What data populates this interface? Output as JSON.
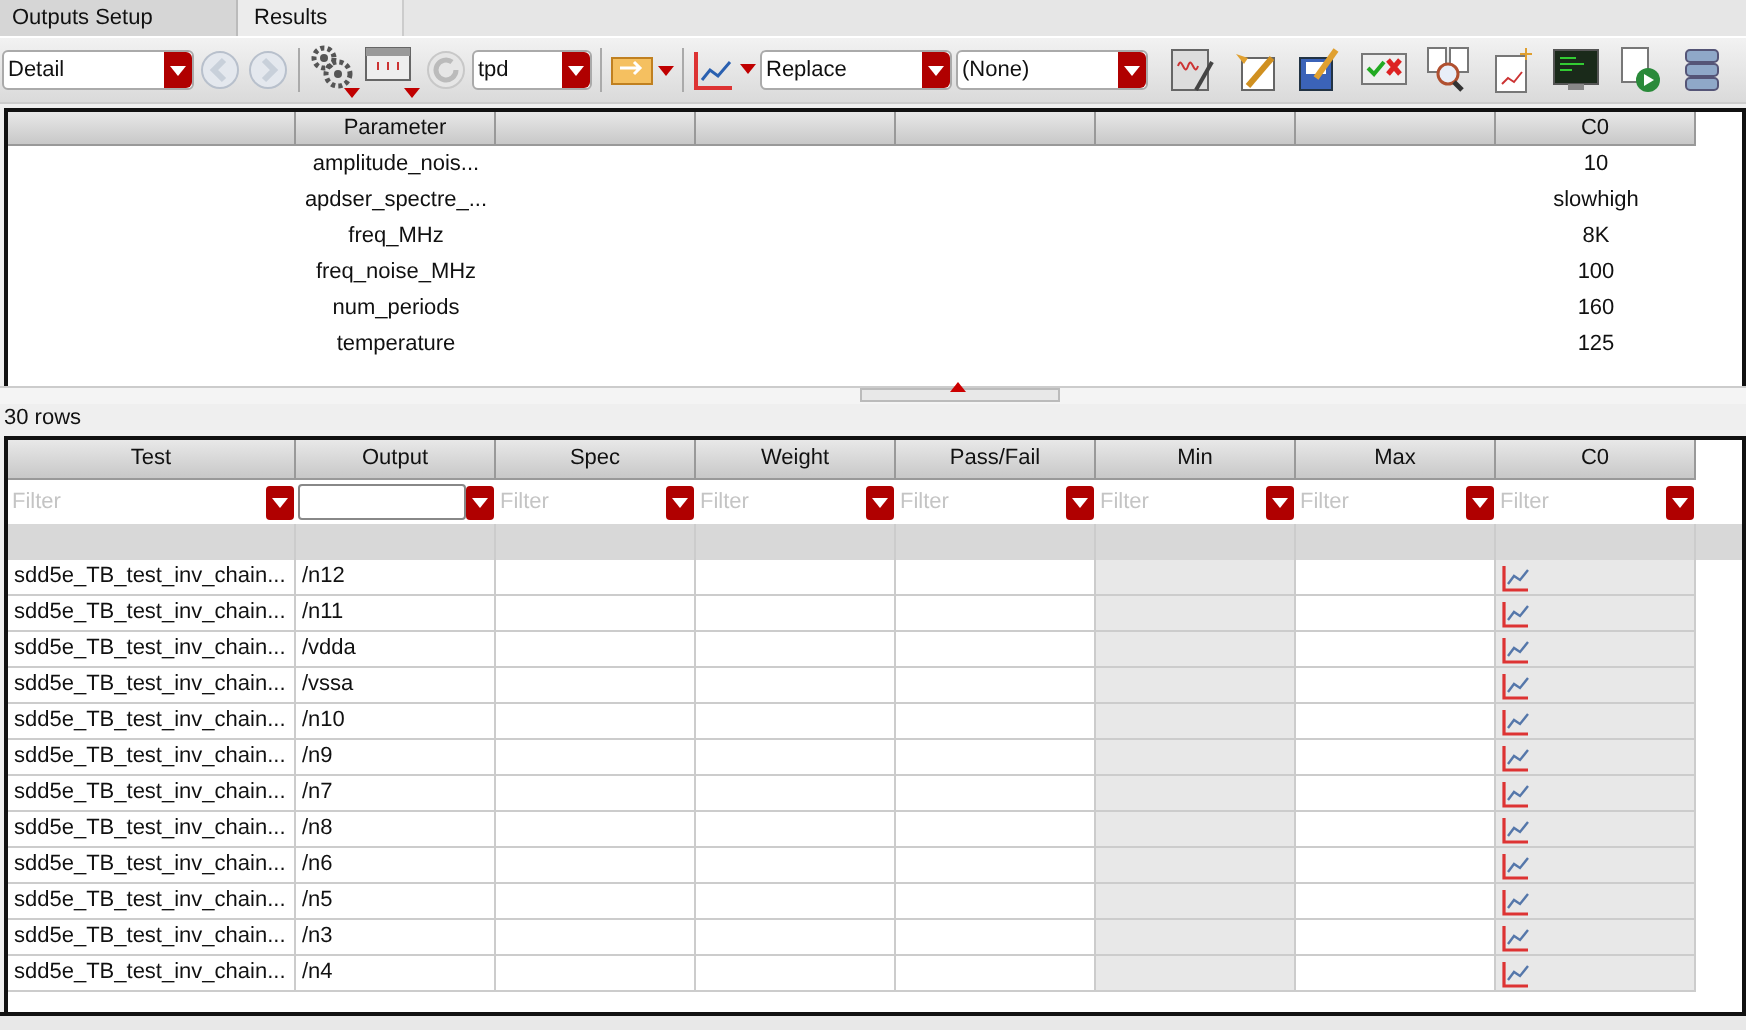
{
  "tabs": [
    {
      "label": "Outputs Setup",
      "selected": false
    },
    {
      "label": "Results",
      "selected": true
    }
  ],
  "toolbar": {
    "view_combo": "Detail",
    "test_combo": "tpd",
    "plot_mode_combo": "Replace",
    "filter_combo": "(None)"
  },
  "parameters": {
    "columns": [
      "Parameter",
      "C0"
    ],
    "rows": [
      {
        "name": "amplitude_nois...",
        "value": "10"
      },
      {
        "name": "apdser_spectre_...",
        "value": "slowhigh"
      },
      {
        "name": "freq_MHz",
        "value": "8K"
      },
      {
        "name": "freq_noise_MHz",
        "value": "100"
      },
      {
        "name": "num_periods",
        "value": "160"
      },
      {
        "name": "temperature",
        "value": "125"
      }
    ]
  },
  "row_count": "30 rows",
  "results": {
    "columns": [
      "Test",
      "Output",
      "Spec",
      "Weight",
      "Pass/Fail",
      "Min",
      "Max",
      "C0"
    ],
    "filters": [
      {
        "placeholder": "Filter",
        "focused": false
      },
      {
        "focused": true
      },
      {
        "placeholder": "Filter",
        "focused": false
      },
      {
        "placeholder": "Filter",
        "focused": false
      },
      {
        "placeholder": "Filter",
        "focused": false
      },
      {
        "placeholder": "Filter",
        "focused": false
      },
      {
        "placeholder": "Filter",
        "focused": false
      },
      {
        "placeholder": "Filter",
        "focused": false
      }
    ],
    "rows": [
      {
        "test": "sdd5e_TB_test_inv_chain...",
        "output": "/n12"
      },
      {
        "test": "sdd5e_TB_test_inv_chain...",
        "output": "/n11"
      },
      {
        "test": "sdd5e_TB_test_inv_chain...",
        "output": "/vdda"
      },
      {
        "test": "sdd5e_TB_test_inv_chain...",
        "output": "/vssa"
      },
      {
        "test": "sdd5e_TB_test_inv_chain...",
        "output": "/n10"
      },
      {
        "test": "sdd5e_TB_test_inv_chain...",
        "output": "/n9"
      },
      {
        "test": "sdd5e_TB_test_inv_chain...",
        "output": "/n7"
      },
      {
        "test": "sdd5e_TB_test_inv_chain...",
        "output": "/n8"
      },
      {
        "test": "sdd5e_TB_test_inv_chain...",
        "output": "/n6"
      },
      {
        "test": "sdd5e_TB_test_inv_chain...",
        "output": "/n5"
      },
      {
        "test": "sdd5e_TB_test_inv_chain...",
        "output": "/n3"
      },
      {
        "test": "sdd5e_TB_test_inv_chain...",
        "output": "/n4"
      }
    ]
  }
}
